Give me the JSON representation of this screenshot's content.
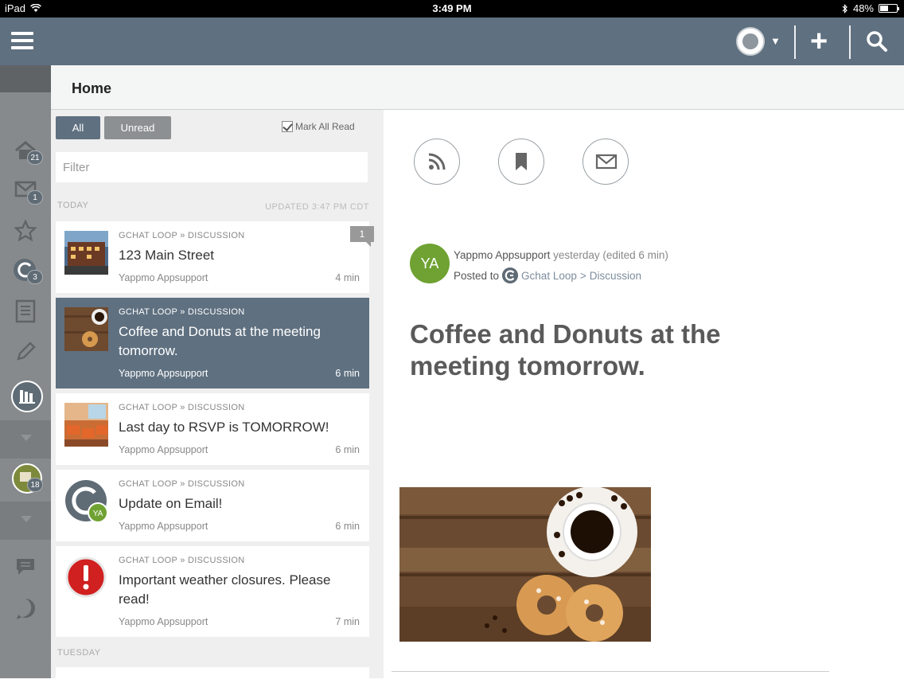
{
  "status": {
    "device": "iPad",
    "time": "3:49 PM",
    "battery": "48%"
  },
  "header": {
    "title": "Home"
  },
  "sidebar": {
    "items": [
      {
        "name": "home",
        "badge": "21"
      },
      {
        "name": "messages",
        "badge": "1"
      },
      {
        "name": "favorites",
        "badge": ""
      },
      {
        "name": "loops",
        "badge": "3"
      },
      {
        "name": "notes",
        "badge": ""
      },
      {
        "name": "edit",
        "badge": ""
      },
      {
        "name": "reports",
        "badge": ""
      },
      {
        "name": "group",
        "badge": "18"
      },
      {
        "name": "chat",
        "badge": ""
      },
      {
        "name": "help",
        "badge": ""
      }
    ]
  },
  "list": {
    "filter_all": "All",
    "filter_unread": "Unread",
    "mark_all_read": "Mark All Read",
    "filter_placeholder": "Filter",
    "section_today": "TODAY",
    "updated": "UPDATED 3:47 PM CDT",
    "section_tuesday": "TUESDAY",
    "items": [
      {
        "crumb": "GCHAT LOOP » DISCUSSION",
        "title": "123 Main Street",
        "author": "Yappmo Appsupport",
        "time": "4 min",
        "comments": "1"
      },
      {
        "crumb": "GCHAT LOOP » DISCUSSION",
        "title": "Coffee and Donuts at the meeting tomorrow.",
        "author": "Yappmo Appsupport",
        "time": "6 min"
      },
      {
        "crumb": "GCHAT LOOP » DISCUSSION",
        "title": "Last day to RSVP is TOMORROW!",
        "author": "Yappmo Appsupport",
        "time": "6 min"
      },
      {
        "crumb": "GCHAT LOOP » DISCUSSION",
        "title": "Update on Email!",
        "author": "Yappmo Appsupport",
        "time": "6 min",
        "avatar": "YA"
      },
      {
        "crumb": "GCHAT LOOP » DISCUSSION",
        "title": "Important weather closures. Please read!",
        "author": "Yappmo Appsupport",
        "time": "7 min"
      }
    ]
  },
  "detail": {
    "avatar": "YA",
    "author": "Yappmo Appsupport",
    "when": "yesterday (edited 6 min)",
    "posted_to": "Posted to",
    "loop": "Gchat Loop",
    "sep": ">",
    "channel": "Discussion",
    "title": "Coffee and Donuts at the meeting tomorrow."
  },
  "colors": {
    "bar": "#5f7080",
    "sidebar": "#878a8c",
    "avatar": "#6fa232"
  }
}
